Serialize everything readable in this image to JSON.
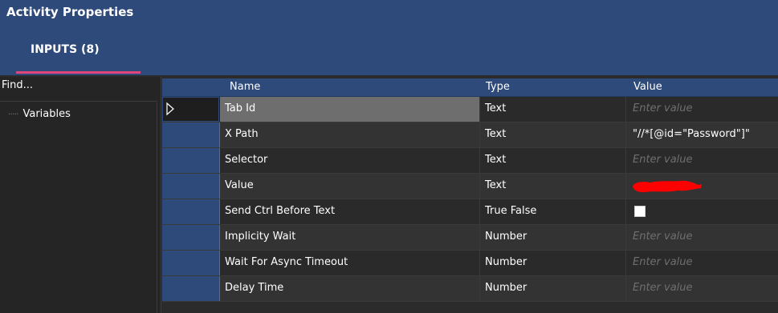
{
  "window": {
    "title": "Activity Properties"
  },
  "tabs": [
    {
      "label": "INPUTS (8)"
    }
  ],
  "left_panel": {
    "find_label": "Find...",
    "tree_items": [
      {
        "label": "Variables"
      }
    ]
  },
  "grid": {
    "columns": {
      "name": "Name",
      "type": "Type",
      "value": "Value"
    },
    "rows": [
      {
        "name": "Tab Id",
        "type": "Text",
        "value": "",
        "placeholder": "Enter value"
      },
      {
        "name": "X Path",
        "type": "Text",
        "value": "\"//*[@id=\"Password\"]\"",
        "placeholder": ""
      },
      {
        "name": "Selector",
        "type": "Text",
        "value": "",
        "placeholder": "Enter value"
      },
      {
        "name": "Value",
        "type": "Text",
        "value": "",
        "placeholder": ""
      },
      {
        "name": "Send Ctrl Before Text",
        "type": "True False",
        "value": "",
        "placeholder": ""
      },
      {
        "name": "Implicity Wait",
        "type": "Number",
        "value": "",
        "placeholder": "Enter value"
      },
      {
        "name": "Wait For Async Timeout",
        "type": "Number",
        "value": "",
        "placeholder": "Enter value"
      },
      {
        "name": "Delay Time",
        "type": "Number",
        "value": "",
        "placeholder": "Enter value"
      }
    ]
  },
  "colors": {
    "header_bg": "#2e4a7a",
    "tab_underline": "#e0457b",
    "redaction": "#ff0000"
  },
  "icons": {
    "row_indicator": "play-triangle-outline-icon",
    "tree_connector": "tree-dots-icon",
    "checkbox": "checkbox-unchecked-icon"
  }
}
